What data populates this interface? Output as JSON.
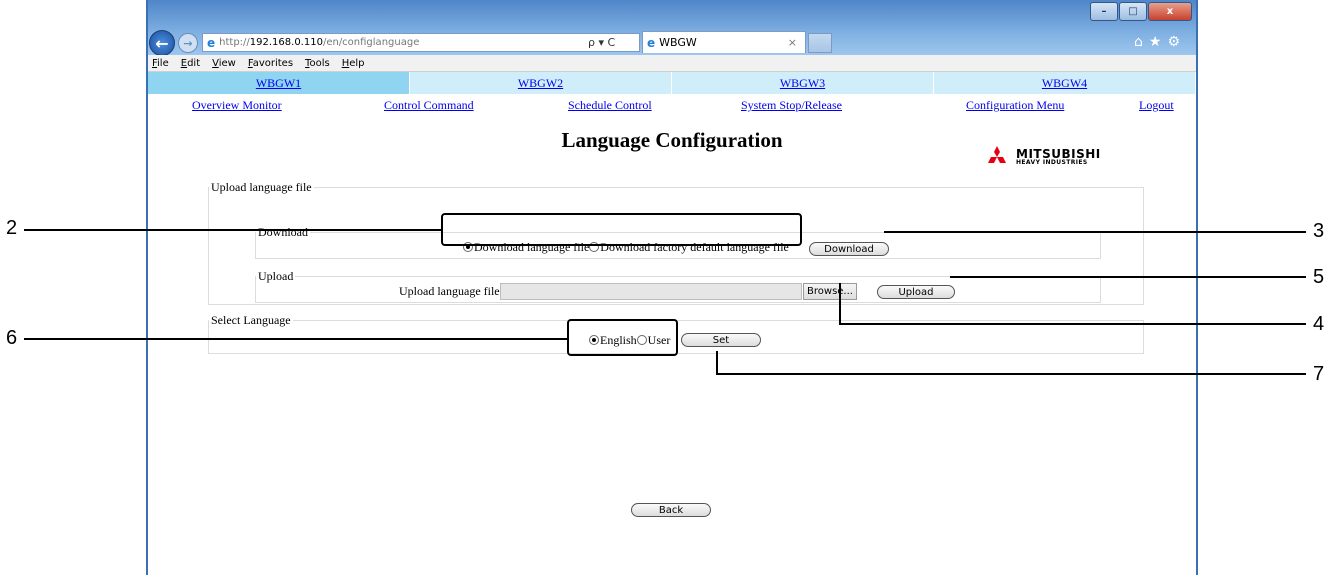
{
  "browser": {
    "url_prefix": "http://",
    "url_host": "192.168.0.110",
    "url_path": "/en/configlanguage",
    "url_tools": "ρ ▾ C",
    "tab_title": "WBGW",
    "tab_close": "×",
    "window_buttons": [
      "–",
      "□",
      "x"
    ],
    "menu": [
      "File",
      "Edit",
      "View",
      "Favorites",
      "Tools",
      "Help"
    ]
  },
  "gateways": [
    "WBGW1",
    "WBGW2",
    "WBGW3",
    "WBGW4"
  ],
  "nav": {
    "overview": "Overview Monitor",
    "control": "Control Command",
    "schedule": "Schedule Control",
    "system": "System Stop/Release",
    "config": "Configuration Menu",
    "logout": "Logout"
  },
  "page": {
    "title": "Language Configuration",
    "logo_line1": "MITSUBISHI",
    "logo_line2": "HEAVY INDUSTRIES"
  },
  "upload_section": {
    "legend": "Upload language file",
    "download_legend": "Download",
    "opt_download": "Download language file",
    "opt_factory": "Download factory default language file",
    "download_btn": "Download",
    "upload_legend": "Upload",
    "upload_label": "Upload language file:",
    "browse_btn": "Browse...",
    "upload_btn": "Upload"
  },
  "select_section": {
    "legend": "Select Language",
    "opt_english": "English",
    "opt_user": "User",
    "set_btn": "Set"
  },
  "back_btn": "Back",
  "callouts": [
    "2",
    "3",
    "5",
    "4",
    "6",
    "7"
  ],
  "colors": {
    "tab_bg": "#cfeefa",
    "tab_active": "#8fd4f0",
    "link": "#0000ee",
    "logo_red": "#e60012"
  }
}
